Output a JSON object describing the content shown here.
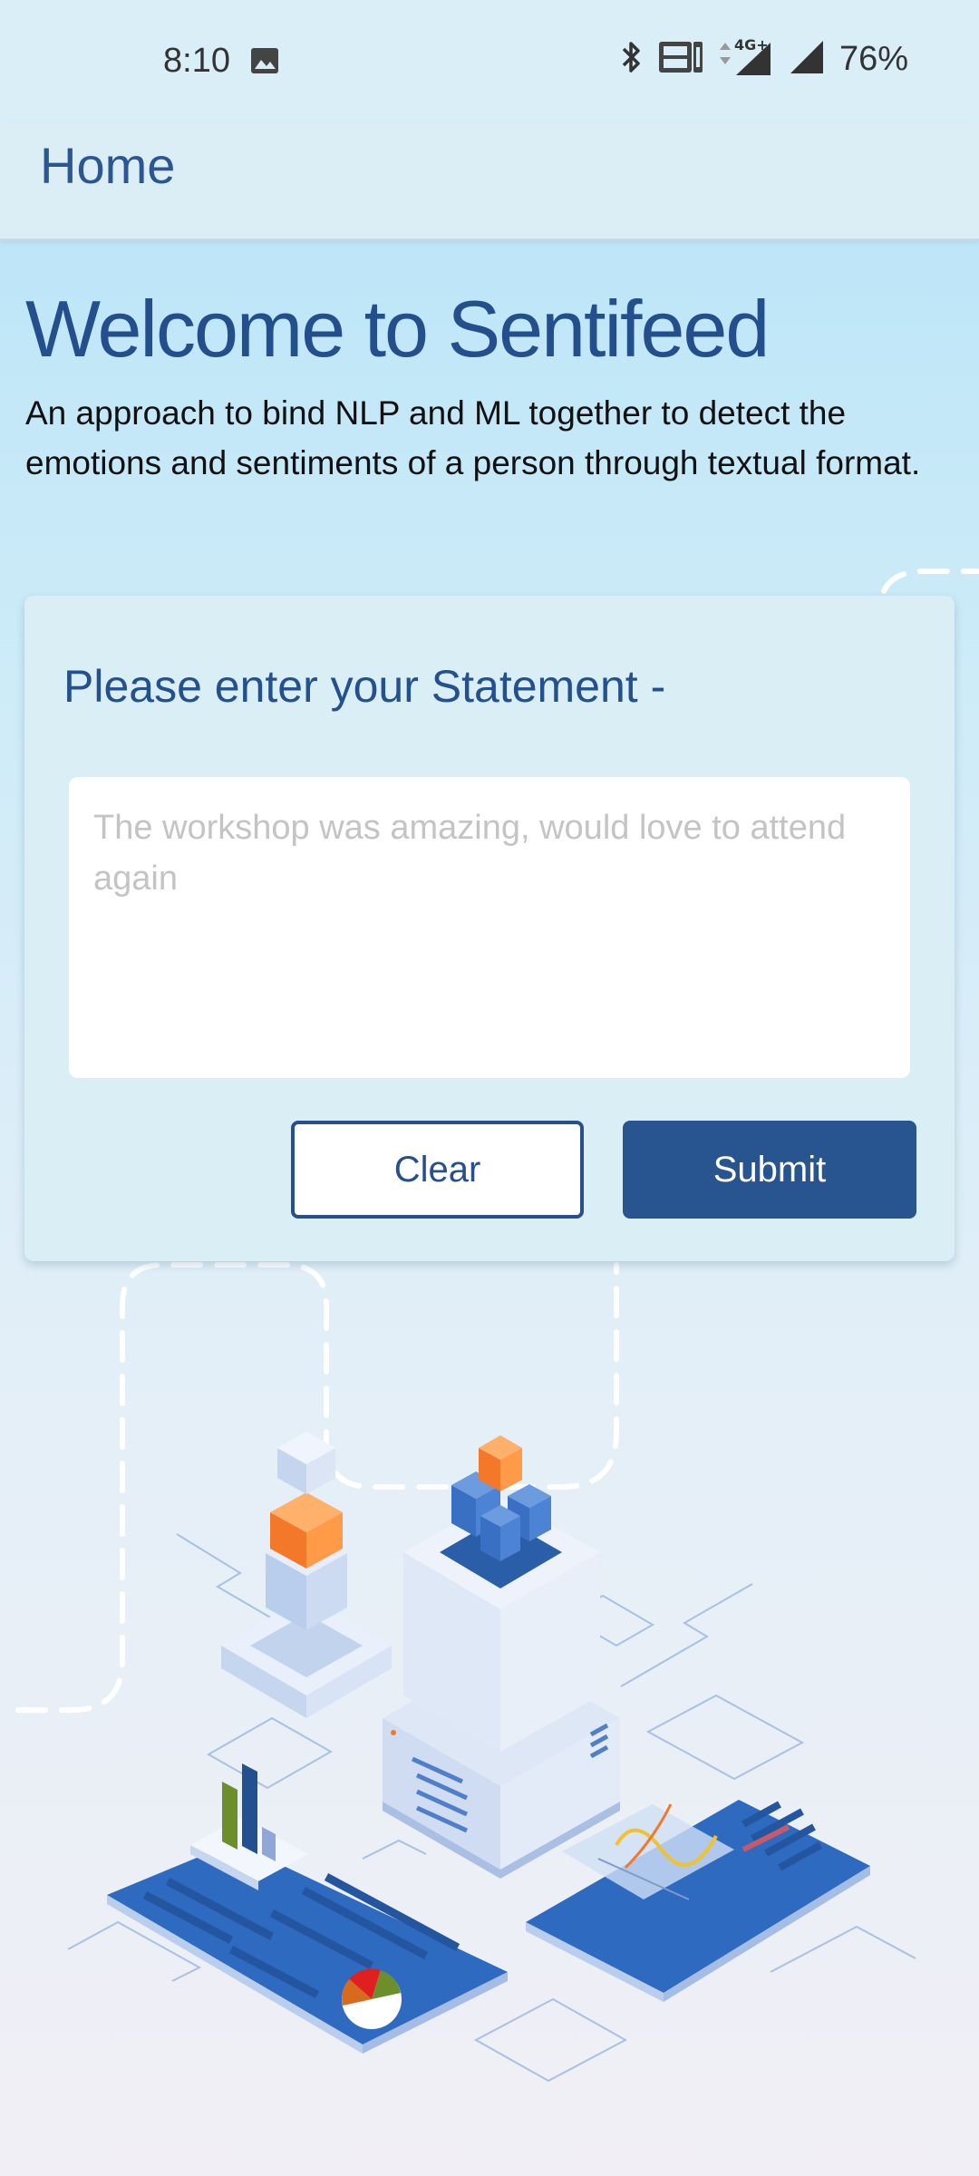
{
  "status_bar": {
    "time": "8:10",
    "battery": "76%",
    "icons": [
      "gallery-icon",
      "bluetooth-icon",
      "volte-icon",
      "4g-icon",
      "signal-icon",
      "signal-icon"
    ],
    "network_label": "4G+",
    "volte_label": "VoLTE 1"
  },
  "app_bar": {
    "title": "Home"
  },
  "hero": {
    "heading": "Welcome to Sentifeed",
    "description": "An approach to bind NLP and ML together to detect the emotions and sentiments of a person through textual format."
  },
  "form": {
    "prompt": "Please enter your Statement -",
    "statement_value": "",
    "statement_placeholder": "The workshop was amazing, would love to attend again",
    "clear_label": "Clear",
    "submit_label": "Submit"
  },
  "colors": {
    "primary": "#285590",
    "heading": "#234f8c",
    "card_bg": "#daeef6",
    "page_top": "#b4e3f8",
    "accent_orange": "#ff8f3a",
    "illustration_blue": "#2d6ac0"
  }
}
